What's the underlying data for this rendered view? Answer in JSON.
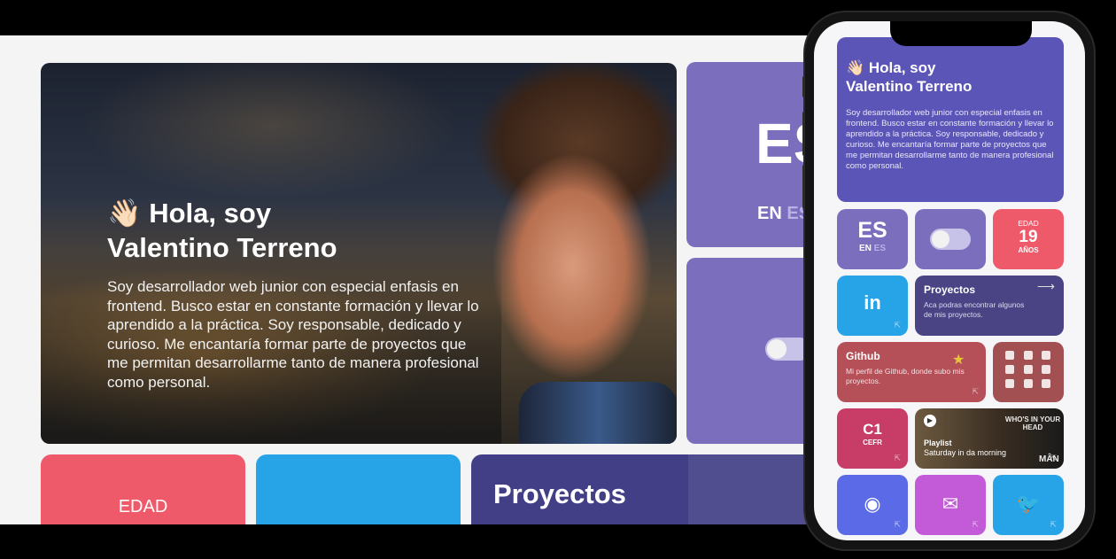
{
  "desktop": {
    "hero": {
      "wave_emoji": "👋🏻",
      "title_line1": "Hola, soy",
      "title_line2": "Valentino Terreno",
      "description": "Soy desarrollador web junior con especial enfasis en frontend. Busco estar en constante formación y llevar lo aprendido a la práctica. Soy responsable, dedicado y curioso. Me encantaría formar parte de proyectos que me permitan desarrollarme tanto de manera profesional como personal."
    },
    "language": {
      "big": "ES",
      "small_prefix": "EN",
      "small_current": "ES"
    },
    "theme_toggle": {
      "state": "off"
    },
    "age": {
      "label": "EDAD"
    },
    "projects": {
      "title": "Proyectos"
    }
  },
  "mobile": {
    "hero": {
      "title_line1": "👋🏻 Hola, soy",
      "title_line2": "Valentino Terreno",
      "description": "Soy desarrollador web junior con especial enfasis en frontend. Busco estar en constante formación y llevar lo aprendido a la práctica. Soy responsable, dedicado y curioso. Me encantaría formar parte de proyectos que me permitan desarrollarme tanto de manera profesional como personal."
    },
    "language": {
      "big": "ES",
      "small_prefix": "EN",
      "small_current": "ES"
    },
    "age": {
      "label": "EDAD",
      "value": "19",
      "unit": "AÑOS"
    },
    "linkedin": {
      "icon": "in"
    },
    "projects": {
      "title": "Proyectos",
      "description": "Aca podras encontrar algunos de mis proyectos.",
      "arrow": "⟶"
    },
    "github": {
      "title": "Github",
      "description": "Mi perfil de Github, donde subo mis proyectos."
    },
    "tech_icons": [
      "html5-icon",
      "css3-icon",
      "image-icon",
      "angular-icon",
      "js-icon",
      "git-icon",
      "puzzle-icon",
      "gear-icon",
      "app-icon"
    ],
    "cefr": {
      "level": "C1",
      "label": "CEFR"
    },
    "playlist": {
      "title": "Playlist",
      "subtitle": "Saturday in da morning",
      "cover_text": "WHO'S IN YOUR HEAD",
      "cover_text2": "MÂN"
    },
    "external_link_glyph": "⇱"
  },
  "colors": {
    "purple": "#7b6fbd",
    "red": "#ef5a6a",
    "blue": "#27a3e8",
    "indigo": "#433f86"
  }
}
